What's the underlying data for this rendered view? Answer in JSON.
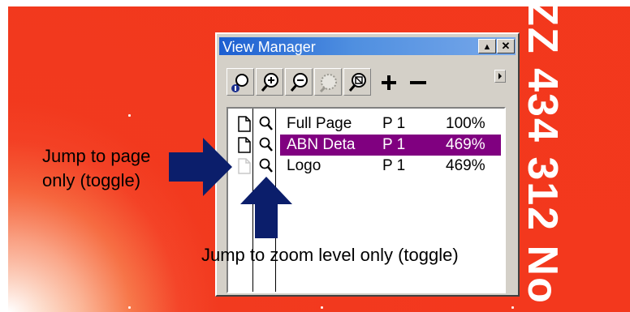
{
  "window": {
    "title": "View Manager",
    "minimize_glyph": "▲",
    "close_glyph": "✕"
  },
  "toolbar": {
    "tools": [
      {
        "name": "zoom-to-view-icon"
      },
      {
        "name": "zoom-in-icon"
      },
      {
        "name": "zoom-out-icon"
      },
      {
        "name": "zoom-selection-icon"
      },
      {
        "name": "zoom-fit-icon"
      },
      {
        "name": "add-view-icon",
        "glyph": "+"
      },
      {
        "name": "delete-view-icon",
        "glyph": "−"
      }
    ]
  },
  "views": [
    {
      "name": "Full Page",
      "page": "P 1",
      "zoom": "100%",
      "page_icon_active": true,
      "selected": false
    },
    {
      "name": "ABN Deta",
      "page": "P 1",
      "zoom": "469%",
      "page_icon_active": true,
      "selected": true
    },
    {
      "name": "Logo",
      "page": "P 1",
      "zoom": "469%",
      "page_icon_active": false,
      "selected": false
    }
  ],
  "annotations": {
    "jump_page_line1": "Jump to page",
    "jump_page_line2": "only (toggle)",
    "jump_zoom": "Jump to zoom level only (toggle)"
  },
  "background_text": "ZZ 434 312 No",
  "colors": {
    "canvas_red": "#f3381d",
    "selection": "#800080",
    "titlebar": "#1c5ed1",
    "arrow_navy": "#0b1e6b"
  }
}
